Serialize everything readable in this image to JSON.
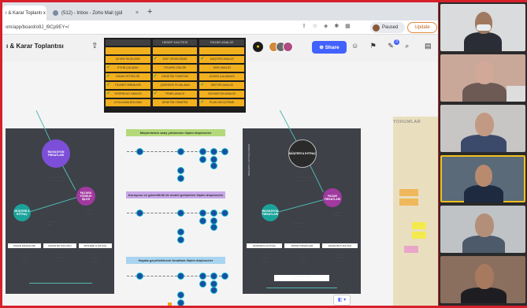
{
  "browser": {
    "tabs": [
      {
        "label": "ı & Karar Toplantı x",
        "active": true
      },
      {
        "label": "(512) - Inbox - Zoho Mail (gül",
        "active": false
      }
    ],
    "url": "om/app/board/o9J_l9Cp9EY=/",
    "profile_label": "Paused",
    "update_label": "Update"
  },
  "toolbar": {
    "board_title": "ı & Karar Toplantısı",
    "share_label": "Share",
    "notification_count": "3"
  },
  "orange_table": {
    "headers": [
      "",
      "HEDEF KALİTESİ",
      "PAZAR ANALİZİ"
    ],
    "rows": [
      [
        "",
        "",
        ""
      ],
      [
        "ÇEVRE İNCELEME",
        "EKİP GEREKSİNİM",
        "MÜŞTERİ ANALİZİ"
      ],
      [
        "ETKİN ÇALIŞMA",
        "TEDARİK ZİNCİRİ",
        "RİSK ANALİZİ"
      ],
      [
        "İNSAN YETERLİĞİ",
        "DENETİM YÖNETİMİ",
        "GÜVEN ÇALIŞMASI"
      ],
      [
        "TİCARET BİRİMLERİ",
        "ÇEKİRDEK PLANLAMA",
        "SEKTÖR ANALİZİ"
      ],
      [
        "YATIRIM ALT ANALİZİ",
        "TEMEL ANALİZ",
        "İNOVASYON ANALİZİ"
      ],
      [
        "UYGULAMA BÖLÜMÜ",
        "DENETİM YÖNETİM",
        "PLAN GELİŞTİRME"
      ]
    ]
  },
  "mid_labels": [
    "Müşterimizin satış yöntemine ilişkin düşünceler",
    "Koruyucu ve güvenilirlik ile model gelişimine ilişkin düşünceler",
    "Hayata geçirilebilecek fırsatlara ilişkin düşünceler"
  ],
  "left_panel": {
    "circle_top": "İNOVASYON FIRSATLARI",
    "circle_right": "PAZARA YÖNELİK İŞLER",
    "circle_left": "MÜŞTERİ & İHTİYAÇ",
    "columns": [
      "PAZAR FIRSATLARI",
      "PAZAR BÜYÜKLÜĞÜ",
      "MÜŞTERİ & İHTİYAÇ"
    ]
  },
  "right_panel": {
    "vertical_label": "BEKLENTİ / İHTİYAÇLARIMIZ",
    "circle_top": "MÜŞTERİ & İHTİYAÇ",
    "circle_right": "PAZAR FIRSATLARI",
    "circle_left": "İNOVASYON FIRSATLARI",
    "columns": [
      "MÜŞTERİ & İHTİYAÇ",
      "PAZAR FIRSATLARI",
      "PAZAR BÜYÜKLÜĞÜ"
    ]
  },
  "comments": {
    "title": "YORUMLAR"
  },
  "colors": {
    "share_blue": "#4262ff",
    "orange": "#f2b01e",
    "purple": "#7d4fd8",
    "magenta": "#a1399f",
    "teal": "#1aa39a",
    "frame_red": "#d6202a"
  },
  "video_participants": 6
}
